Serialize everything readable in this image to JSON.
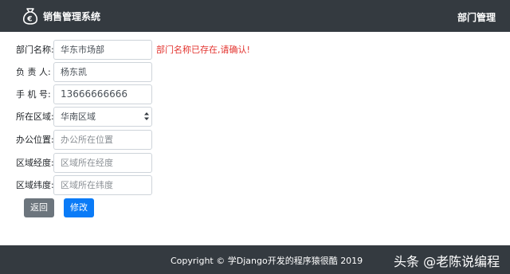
{
  "app": {
    "brand": "销售管理系统",
    "nav_link": "部门管理"
  },
  "form": {
    "department_name": {
      "label": "部门名称:",
      "value": "华东市场部"
    },
    "manager": {
      "label": "负 责 人:",
      "value": "杨东凯"
    },
    "phone": {
      "label": "手 机 号:",
      "value": "13666666666"
    },
    "region": {
      "label": "所在区域:",
      "selected": "华南区域"
    },
    "office_location": {
      "label": "办公位置:",
      "placeholder": "办公所在位置"
    },
    "longitude": {
      "label": "区域经度:",
      "placeholder": "区域所在经度"
    },
    "latitude": {
      "label": "区域纬度:",
      "placeholder": "区域所在纬度"
    },
    "error": "部门名称已存在,请确认!"
  },
  "buttons": {
    "back": "返回",
    "edit": "修改"
  },
  "footer": {
    "copyright": "Copyright © 学Django开发的程序猿很酷 2019",
    "watermark": "头条 @老陈说编程"
  },
  "colors": {
    "navbar": "#343a40",
    "error": "#e3342f",
    "primary": "#0a7bf7",
    "secondary": "#6c757d"
  }
}
